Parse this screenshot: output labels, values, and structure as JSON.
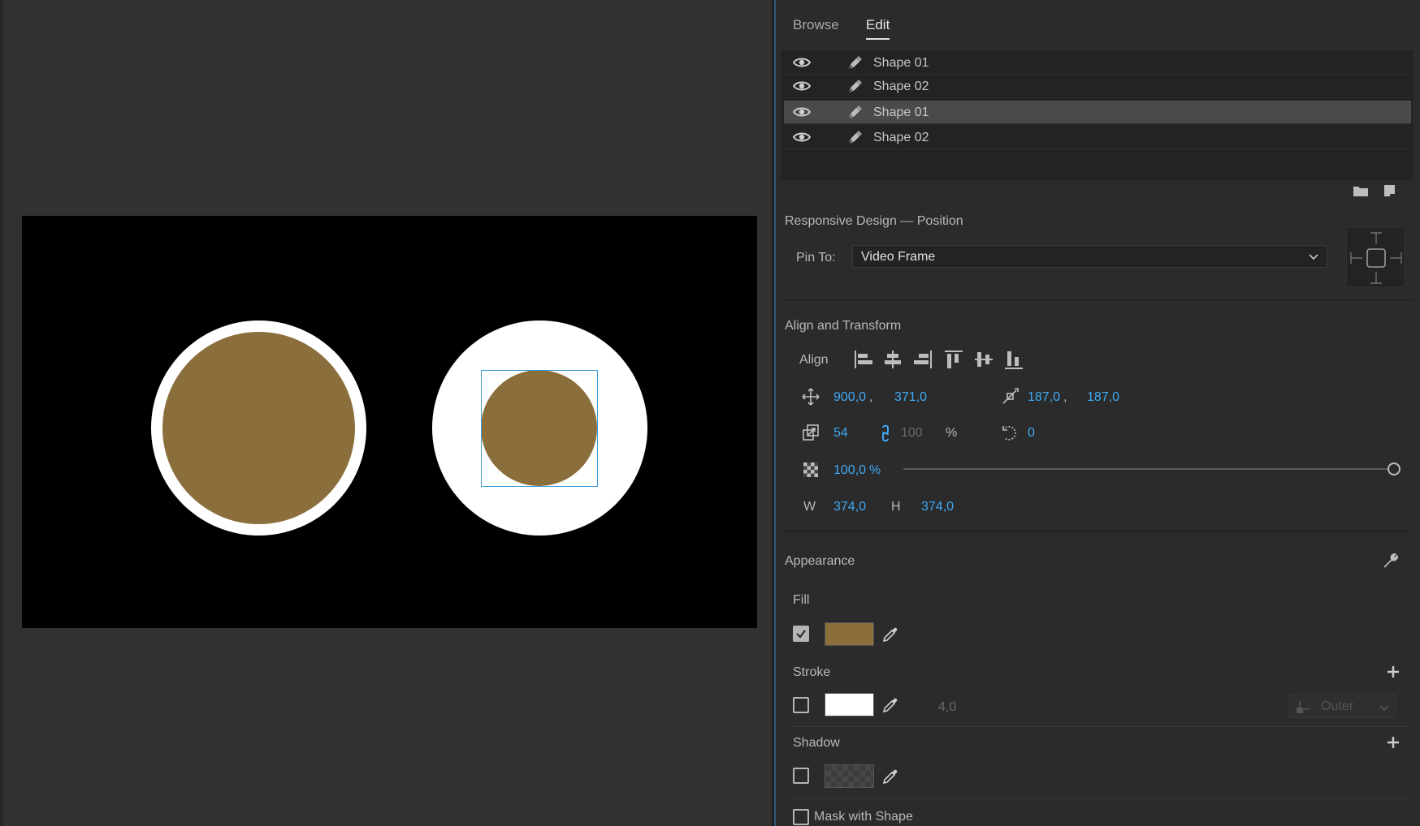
{
  "tabs": [
    {
      "label": "Browse",
      "active": false
    },
    {
      "label": "Edit",
      "active": true
    }
  ],
  "layers": [
    {
      "name": "Shape 01",
      "selected": false
    },
    {
      "name": "Shape 02",
      "selected": false
    },
    {
      "name": "Shape 01",
      "selected": true
    },
    {
      "name": "Shape 02",
      "selected": false
    }
  ],
  "responsive": {
    "title": "Responsive Design — Position",
    "pin_label": "Pin To:",
    "pin_value": "Video Frame"
  },
  "align_transform": {
    "title": "Align and Transform",
    "align_label": "Align",
    "position_x": "900,0",
    "position_sep": ",",
    "position_y": "371,0",
    "anchor_x": "187,0",
    "anchor_sep": ",",
    "anchor_y": "187,0",
    "scale": "54",
    "scale_linked": "100",
    "scale_unit": "%",
    "rotation": "0",
    "opacity": "100,0",
    "opacity_unit": "%",
    "opacity_fraction": 1.0,
    "w_label": "W",
    "width": "374,0",
    "h_label": "H",
    "height": "374,0"
  },
  "appearance": {
    "title": "Appearance",
    "fill_label": "Fill",
    "fill_enabled": true,
    "fill_color": "#8a6f3c",
    "stroke_label": "Stroke",
    "stroke_enabled": false,
    "stroke_color": "#ffffff",
    "stroke_width": "4,0",
    "stroke_type": "Outer",
    "shadow_label": "Shadow",
    "shadow_enabled": false,
    "mask_label": "Mask with Shape"
  },
  "canvas": {
    "frame_color": "#000000",
    "shape_fill": "#8a6f3c",
    "ring_color": "#ffffff",
    "selection_color": "#3a9ad9"
  }
}
